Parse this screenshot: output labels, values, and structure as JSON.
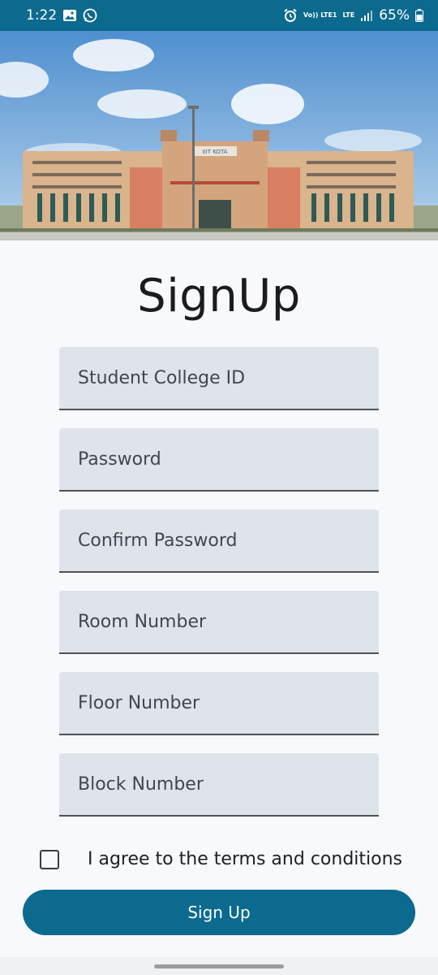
{
  "status_bar": {
    "time": "1:22",
    "net_volte": "Vo)) LTE1",
    "net_lte": "LTE",
    "battery": "65%",
    "icons": [
      "gallery-icon",
      "whatsapp-icon",
      "alarm-icon",
      "signal-icon",
      "battery-icon"
    ]
  },
  "hero": {
    "building_sign": "IIIT KOTA"
  },
  "page": {
    "title": "SignUp"
  },
  "form": {
    "fields": [
      {
        "placeholder": "Student College ID",
        "value": ""
      },
      {
        "placeholder": "Password",
        "value": ""
      },
      {
        "placeholder": "Confirm Password",
        "value": ""
      },
      {
        "placeholder": "Room Number",
        "value": ""
      },
      {
        "placeholder": "Floor Number",
        "value": ""
      },
      {
        "placeholder": "Block Number",
        "value": ""
      }
    ],
    "terms_label": "I agree to the terms and conditions",
    "terms_checked": false,
    "submit_label": "Sign Up"
  },
  "colors": {
    "primary": "#0b6a8e",
    "field_bg": "#dfe4ea",
    "page_bg": "#f8f9fc"
  }
}
